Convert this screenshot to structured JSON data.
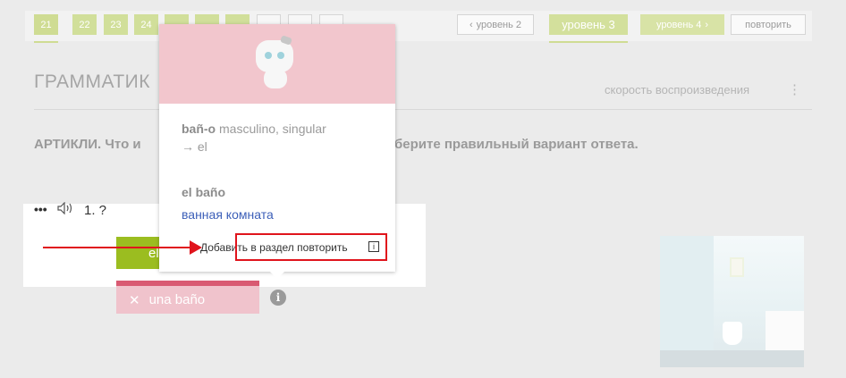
{
  "lessons": {
    "items": [
      {
        "label": "21",
        "state": "active"
      },
      {
        "label": "22",
        "state": "green"
      },
      {
        "label": "23",
        "state": "green"
      },
      {
        "label": "24",
        "state": "green"
      },
      {
        "label": "",
        "state": "green"
      },
      {
        "label": "",
        "state": "green"
      },
      {
        "label": "",
        "state": "green"
      },
      {
        "label": "",
        "state": "empty"
      },
      {
        "label": "",
        "state": "empty"
      },
      {
        "label": "",
        "state": "empty"
      }
    ]
  },
  "levels": {
    "prev_label": "уровень 2",
    "prev_icon": "chevron-left-icon",
    "current_label": "уровень 3",
    "next_label": "уровень 4",
    "next_icon": "chevron-right-icon",
    "repeat_label": "повторить"
  },
  "header": {
    "title": "ГРАММАТИК",
    "speed_label": "скорость воспроизведения",
    "speed_icon": "more-vertical-icon"
  },
  "instruction": {
    "part1": "АРТИКЛИ. Что и",
    "part2": "берите правильный вариант ответа."
  },
  "question": {
    "more_icon": "more-horizontal-icon",
    "speaker_icon": "speaker-icon",
    "number": "1. ?",
    "correct_answer": "el",
    "wrong_answer": "una baño",
    "wrong_icon": "close-icon",
    "info_icon": "info-icon"
  },
  "popup": {
    "robot_icon": "robot-mascot-icon",
    "grammar_word": "bañ-o",
    "grammar_desc": "masculino, singular",
    "grammar_result": "→ el",
    "word": "el baño",
    "translation": "ванная комната",
    "add_label": "Добавить в раздел повторить",
    "add_icon": "info-box-icon",
    "add_icon_glyph": "i"
  },
  "colors": {
    "accent_green": "#9bbd20",
    "wrong_pink": "#f0c3cc",
    "annotation_red": "#e0141c",
    "link_blue": "#3c5fb8"
  }
}
